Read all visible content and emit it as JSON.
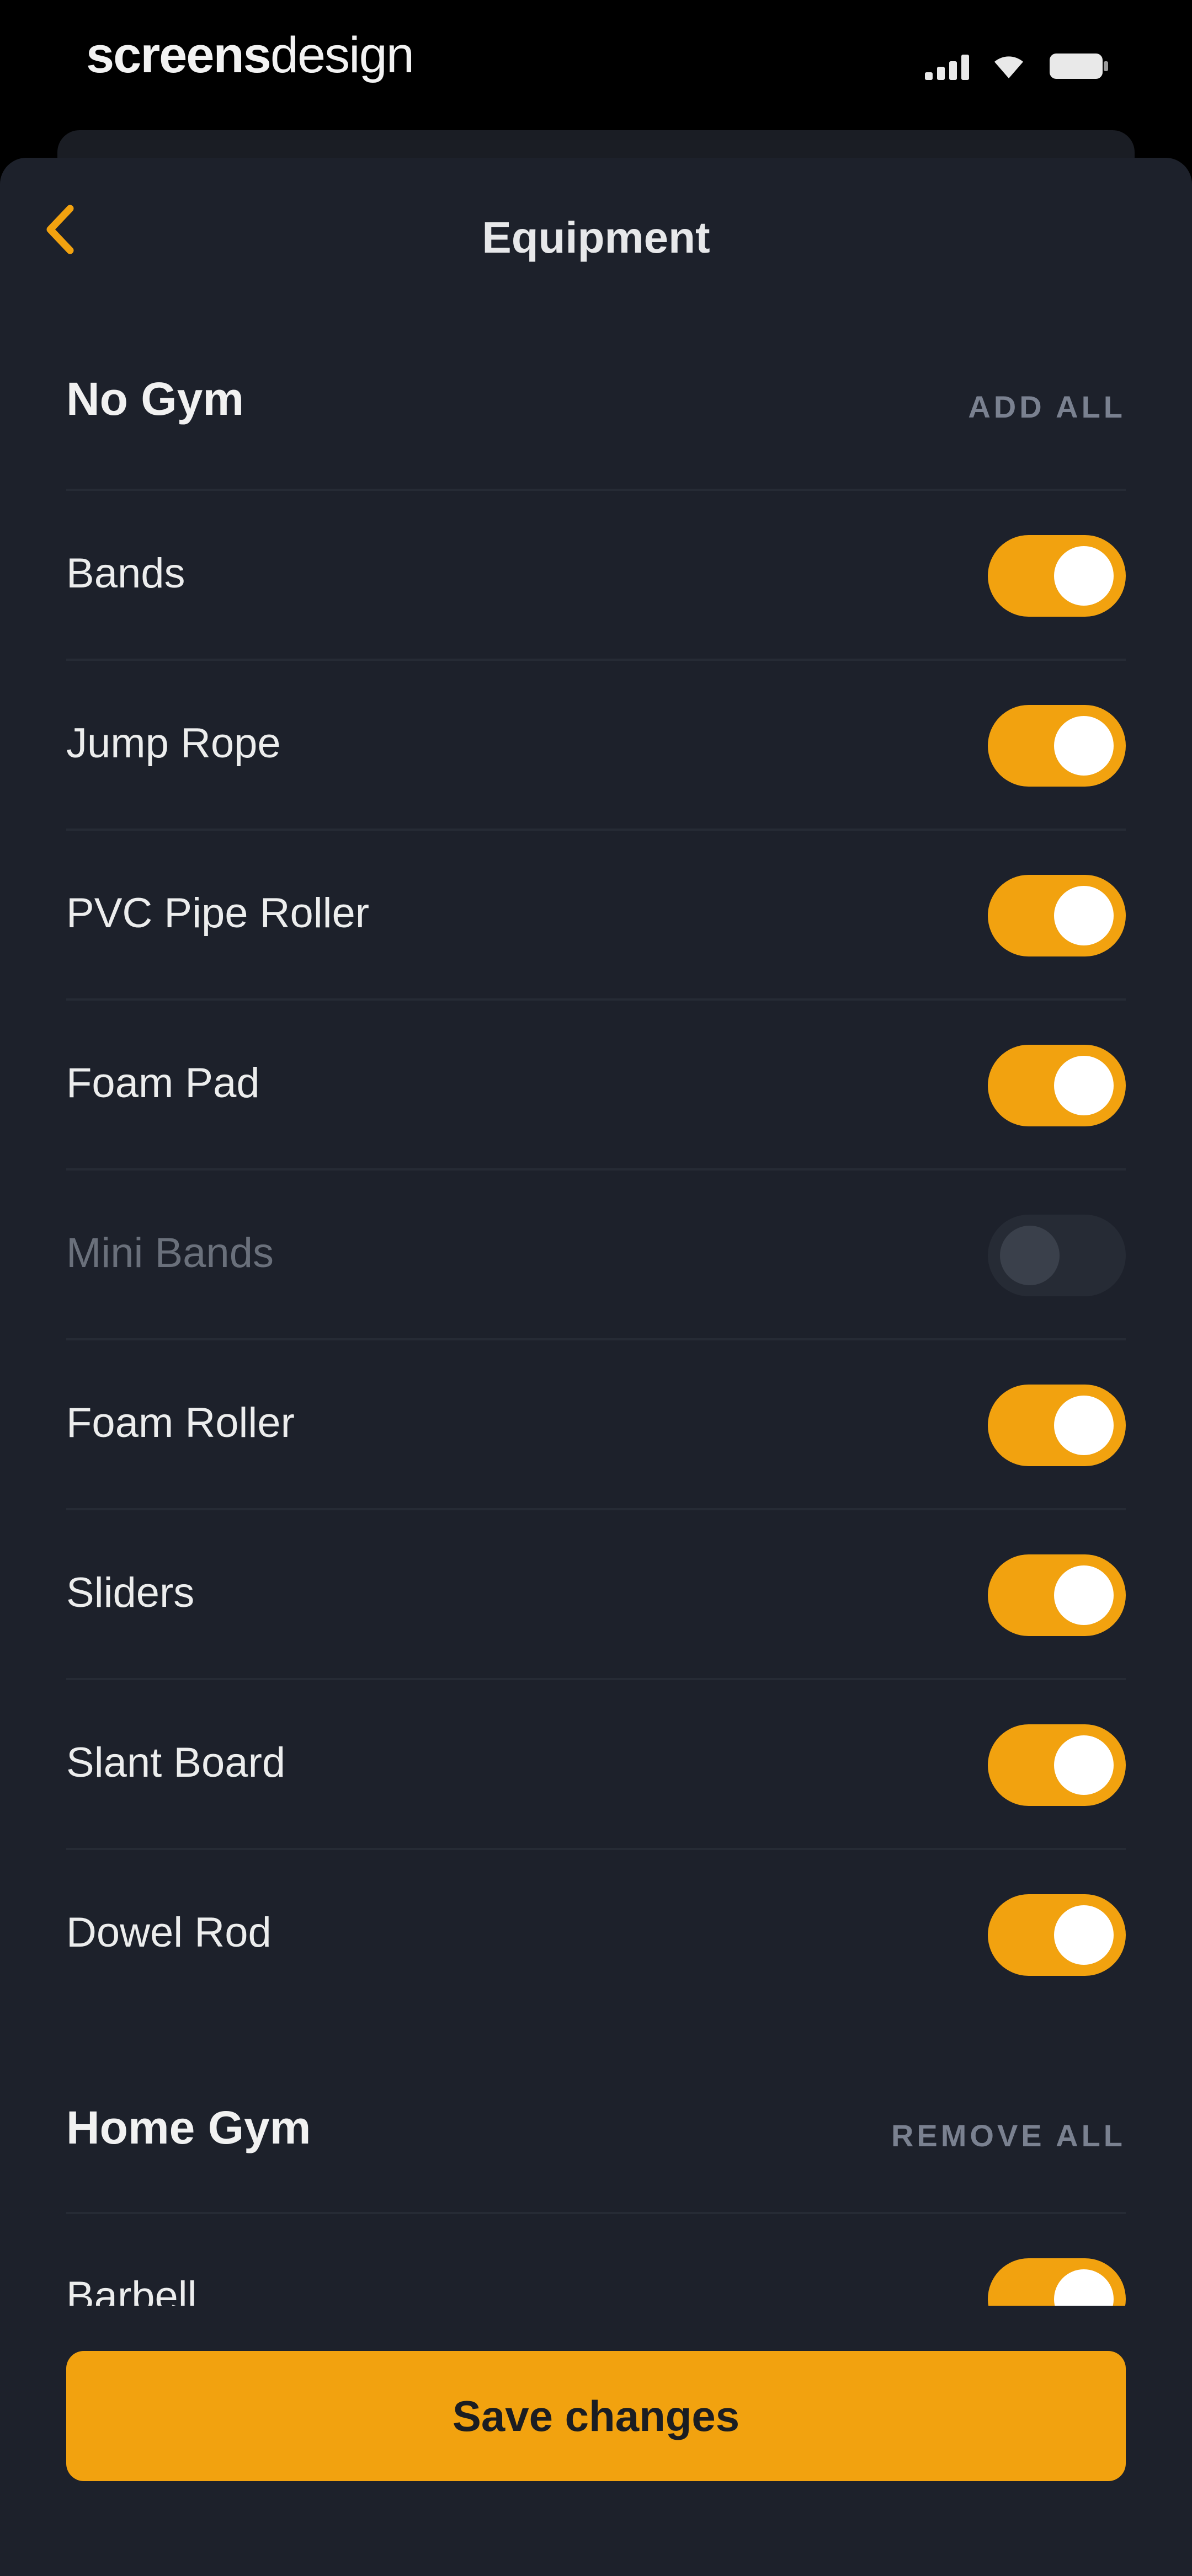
{
  "status_bar": {
    "brand_bold": "screens",
    "brand_light": "design",
    "signal_icon": "cellular-signal-icon",
    "wifi_icon": "wifi-icon",
    "battery_icon": "battery-icon"
  },
  "nav": {
    "title": "Equipment",
    "back_icon": "chevron-left-icon"
  },
  "colors": {
    "accent": "#F2A20F",
    "background": "#1D212B",
    "text": "#ECEDED",
    "muted": "#7A8190"
  },
  "sections": [
    {
      "title": "No Gym",
      "action": "ADD ALL",
      "items": [
        {
          "label": "Bands",
          "on": true
        },
        {
          "label": "Jump Rope",
          "on": true
        },
        {
          "label": "PVC Pipe Roller",
          "on": true
        },
        {
          "label": "Foam Pad",
          "on": true
        },
        {
          "label": "Mini Bands",
          "on": false
        },
        {
          "label": "Foam Roller",
          "on": true
        },
        {
          "label": "Sliders",
          "on": true
        },
        {
          "label": "Slant Board",
          "on": true
        },
        {
          "label": "Dowel Rod",
          "on": true
        }
      ]
    },
    {
      "title": "Home Gym",
      "action": "REMOVE ALL",
      "items": [
        {
          "label": "Barbell",
          "on": true
        }
      ]
    }
  ],
  "footer": {
    "save_label": "Save changes"
  }
}
